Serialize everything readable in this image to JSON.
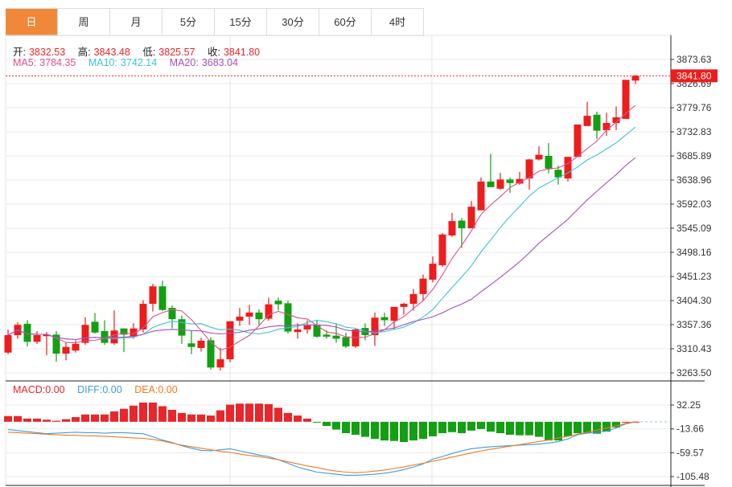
{
  "tabs": [
    {
      "label": "日",
      "active": true
    },
    {
      "label": "周"
    },
    {
      "label": "月"
    },
    {
      "label": "5分"
    },
    {
      "label": "15分"
    },
    {
      "label": "30分"
    },
    {
      "label": "60分"
    },
    {
      "label": "4时"
    }
  ],
  "ohlc_info": {
    "open_label": "开:",
    "open": "3832.53",
    "high_label": "高:",
    "high": "3843.48",
    "low_label": "低:",
    "low": "3825.57",
    "close_label": "收:",
    "close": "3841.80"
  },
  "ma_info": {
    "ma5_label": "MA5:",
    "ma5": "3784.35",
    "ma10_label": "MA10:",
    "ma10": "3742.14",
    "ma20_label": "MA20:",
    "ma20": "3683.04"
  },
  "macd_info": {
    "macd_label": "MACD:",
    "macd": "0.00",
    "diff_label": "DIFF:",
    "diff": "0.00",
    "dea_label": "DEA:",
    "dea": "0.00"
  },
  "colors": {
    "up": "#ee1c1c",
    "down": "#12a012",
    "ma5": "#e0508a",
    "ma10": "#3cc4d4",
    "ma20": "#a650c0",
    "macd": "#e8262b",
    "diff": "#3d9be0",
    "dea": "#f07a22",
    "tab_active": "#f0883a"
  },
  "chart_data": [
    {
      "type": "candlestick",
      "price_ticks": [
        "3873.63",
        "3826.69",
        "3779.76",
        "3732.83",
        "3685.89",
        "3638.96",
        "3592.03",
        "3545.09",
        "3498.16",
        "3451.23",
        "3404.30",
        "3357.36",
        "3310.43",
        "3263.50"
      ],
      "ylim": [
        3263.5,
        3873.63
      ],
      "last_price": "3841.80",
      "grid": true,
      "ma_periods": [
        5,
        10,
        20
      ],
      "candles": [
        [
          3303,
          3348,
          3300,
          3337
        ],
        [
          3337,
          3362,
          3330,
          3357
        ],
        [
          3359,
          3366,
          3315,
          3324
        ],
        [
          3324,
          3345,
          3320,
          3337
        ],
        [
          3335,
          3343,
          3298,
          3338
        ],
        [
          3338,
          3345,
          3285,
          3301
        ],
        [
          3301,
          3322,
          3288,
          3314
        ],
        [
          3307,
          3327,
          3303,
          3320
        ],
        [
          3322,
          3372,
          3318,
          3357
        ],
        [
          3363,
          3380,
          3340,
          3342
        ],
        [
          3345,
          3366,
          3318,
          3322
        ],
        [
          3321,
          3385,
          3318,
          3346
        ],
        [
          3350,
          3350,
          3304,
          3338
        ],
        [
          3335,
          3360,
          3330,
          3350
        ],
        [
          3348,
          3405,
          3342,
          3398
        ],
        [
          3398,
          3437,
          3383,
          3432
        ],
        [
          3432,
          3443,
          3384,
          3386
        ],
        [
          3390,
          3395,
          3350,
          3368
        ],
        [
          3368,
          3375,
          3320,
          3336
        ],
        [
          3321,
          3345,
          3300,
          3314
        ],
        [
          3312,
          3332,
          3305,
          3326
        ],
        [
          3327,
          3333,
          3270,
          3274
        ],
        [
          3274,
          3312,
          3268,
          3290
        ],
        [
          3290,
          3364,
          3284,
          3364
        ],
        [
          3365,
          3390,
          3355,
          3373
        ],
        [
          3373,
          3396,
          3357,
          3381
        ],
        [
          3381,
          3387,
          3355,
          3368
        ],
        [
          3369,
          3410,
          3365,
          3397
        ],
        [
          3404,
          3410,
          3385,
          3397
        ],
        [
          3399,
          3404,
          3340,
          3344
        ],
        [
          3343,
          3360,
          3330,
          3348
        ],
        [
          3348,
          3366,
          3340,
          3356
        ],
        [
          3356,
          3366,
          3332,
          3334
        ],
        [
          3338,
          3347,
          3330,
          3334
        ],
        [
          3336,
          3360,
          3322,
          3330
        ],
        [
          3333,
          3342,
          3312,
          3315
        ],
        [
          3315,
          3350,
          3312,
          3348
        ],
        [
          3351,
          3360,
          3327,
          3337
        ],
        [
          3337,
          3381,
          3316,
          3371
        ],
        [
          3372,
          3381,
          3355,
          3366
        ],
        [
          3365,
          3392,
          3348,
          3392
        ],
        [
          3392,
          3400,
          3377,
          3398
        ],
        [
          3398,
          3427,
          3385,
          3417
        ],
        [
          3417,
          3455,
          3405,
          3447
        ],
        [
          3445,
          3490,
          3440,
          3476
        ],
        [
          3473,
          3536,
          3470,
          3533
        ],
        [
          3531,
          3575,
          3528,
          3559
        ],
        [
          3560,
          3565,
          3507,
          3545
        ],
        [
          3545,
          3598,
          3545,
          3587
        ],
        [
          3580,
          3644,
          3580,
          3636
        ],
        [
          3636,
          3690,
          3625,
          3625
        ],
        [
          3622,
          3653,
          3620,
          3640
        ],
        [
          3640,
          3644,
          3614,
          3633
        ],
        [
          3632,
          3655,
          3630,
          3641
        ],
        [
          3642,
          3680,
          3620,
          3679
        ],
        [
          3679,
          3705,
          3677,
          3688
        ],
        [
          3686,
          3711,
          3652,
          3661
        ],
        [
          3659,
          3667,
          3630,
          3644
        ],
        [
          3642,
          3684,
          3636,
          3684
        ],
        [
          3684,
          3747,
          3684,
          3747
        ],
        [
          3744,
          3791,
          3744,
          3764
        ],
        [
          3766,
          3772,
          3719,
          3735
        ],
        [
          3736,
          3770,
          3725,
          3750
        ],
        [
          3750,
          3782,
          3736,
          3761
        ],
        [
          3758,
          3834,
          3758,
          3834
        ],
        [
          3832.53,
          3843.48,
          3825.57,
          3841.8
        ]
      ]
    },
    {
      "type": "macd",
      "ticks": [
        "32.25",
        "-13.66",
        "-59.57",
        "-105.48"
      ],
      "ylim": [
        -105.48,
        32.25
      ],
      "macd": [
        11,
        11,
        6,
        6,
        4,
        2,
        5,
        9,
        14,
        14,
        14,
        20,
        25,
        31,
        37,
        37,
        30,
        23,
        17,
        14,
        14,
        12,
        22,
        33,
        35,
        35,
        35,
        34,
        27,
        17,
        12,
        6,
        -1,
        -8,
        -15,
        -22,
        -25,
        -29,
        -33,
        -36,
        -37,
        -39,
        -36,
        -33,
        -28,
        -22,
        -20,
        -22,
        -17,
        -14,
        -19,
        -22,
        -25,
        -26,
        -26,
        -29,
        -36,
        -36,
        -28,
        -22,
        -22,
        -23,
        -19,
        -11,
        0,
        0
      ],
      "diff": [
        -15,
        -17,
        -19,
        -21,
        -23,
        -22,
        -21,
        -20,
        -21,
        -21,
        -22,
        -21,
        -21,
        -22,
        -23,
        -29,
        -35,
        -40,
        -46,
        -51,
        -55,
        -56,
        -54,
        -52,
        -56,
        -60,
        -64,
        -67,
        -73,
        -80,
        -87,
        -92,
        -97,
        -99,
        -101,
        -103,
        -103,
        -102,
        -101,
        -99,
        -96,
        -92,
        -87,
        -81,
        -72,
        -67,
        -61,
        -56,
        -52,
        -50,
        -48,
        -47,
        -46,
        -45,
        -44,
        -43,
        -41,
        -38,
        -33,
        -25,
        -22,
        -20,
        -18,
        -12,
        -4,
        0
      ],
      "dea": [
        -20,
        -21,
        -22,
        -23,
        -24,
        -25,
        -26,
        -26,
        -27,
        -27,
        -28,
        -29,
        -30,
        -31,
        -32,
        -34,
        -37,
        -41,
        -45,
        -48,
        -51,
        -54,
        -57,
        -59,
        -62,
        -65,
        -67,
        -70,
        -73,
        -77,
        -81,
        -85,
        -88,
        -92,
        -95,
        -97,
        -98,
        -97,
        -95,
        -93,
        -90,
        -87,
        -83,
        -80,
        -76,
        -72,
        -68,
        -64,
        -60,
        -56,
        -53,
        -50,
        -47,
        -44,
        -41,
        -38,
        -35,
        -31,
        -28,
        -24,
        -20,
        -16,
        -12,
        -8,
        -3,
        0
      ]
    }
  ]
}
